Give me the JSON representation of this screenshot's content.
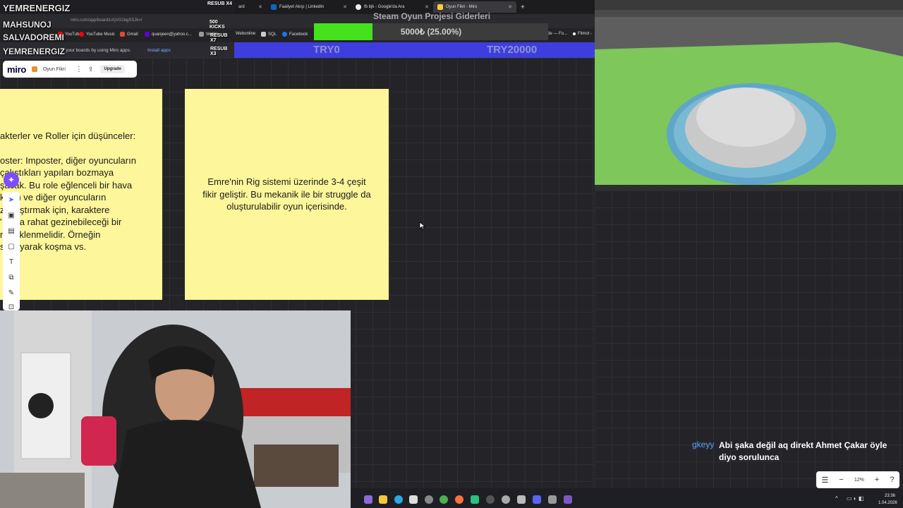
{
  "browser": {
    "tabs": [
      {
        "label": "ard",
        "color": "#888"
      },
      {
        "label": "Faaliyet Akışı | LinkedIn",
        "color": "#0a66c2"
      },
      {
        "label": "fb bjk - Google'da Ara",
        "color": "#eee"
      },
      {
        "label": "Oyun Fikri - Miro",
        "color": "#ffd02f"
      }
    ],
    "url": "miro.com/app/board/uXjVG1bgSSJk=/",
    "bookmarks": [
      "YouTube",
      "YouTube Music",
      "Gmail",
      "quanjeen@yahoo.c...",
      "Weblo",
      "Webonline",
      "SQL",
      "Facebook",
      "de — Fo...",
      "Filmot -"
    ],
    "infobar_text": "to your boards by using Miro apps.",
    "install_apps": "Install apps"
  },
  "donation_goal": {
    "title": "Steam Oyun Projesi Giderleri",
    "amount": "5000₺ (25.00%)",
    "progress_fraction": 0.25,
    "min_label": "TRY0",
    "max_label": "TRY20000",
    "fill_color": "#45e11c",
    "bar_color": "#3e3ee0"
  },
  "alerts": [
    {
      "name": "YEMRENERGIZ",
      "value": "RESUB X4"
    },
    {
      "name": "MAHSUNOJ",
      "value": "500 KICKS"
    },
    {
      "name": "SALVADOREMI",
      "value": "RESUB X7"
    },
    {
      "name": "YEMRENERGIZ",
      "value": "RESUB X3"
    }
  ],
  "miro": {
    "logo": "miro",
    "board_name": "Oyun Fikri",
    "upgrade": "Upgrade",
    "zoom_level": "12%"
  },
  "stickies": {
    "left_lines": [
      "akterler ve Roller için düşünceler:",
      "oster: Imposter, diğer oyuncuların\n  çalıştıkları yapıları bozmaya\nşacak. Bu role eğlenceli bir hava\nk için ve diğer oyuncuların\n  zorlaştırmak için, karaktere\n' daha rahat gezinebileceği bir\nnik eklenmelidir. Örneğin\nsıçrayarak koşma vs."
    ],
    "right_text": "Emre'nin Rig sistemi üzerinde 3-4 çeşit fikir geliştir. Bu mekanik ile bir struggle da oluşturulabilir oyun içerisinde."
  },
  "chat": {
    "user": "gkeyy",
    "user_color": "#5aa0ff",
    "message": "Abi şaka değil aq direkt Ahmet Çakar öyle diyo sorulunca"
  },
  "taskbar": {
    "time": "23:36",
    "date": "1.04.2026"
  }
}
